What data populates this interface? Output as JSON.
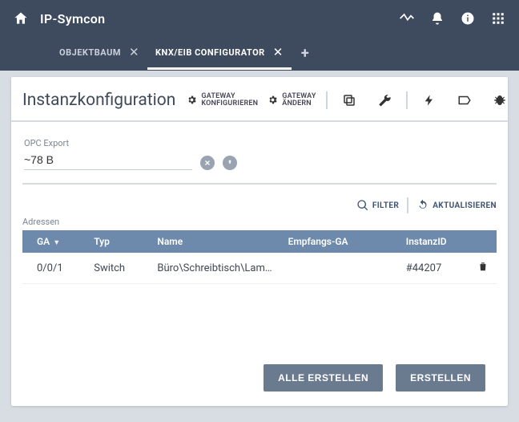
{
  "header": {
    "title": "IP-Symcon"
  },
  "tabs": [
    {
      "label": "OBJEKTBAUM",
      "active": false
    },
    {
      "label": "KNX/EIB CONFIGURATOR",
      "active": true
    }
  ],
  "panel": {
    "title": "Instanzkonfiguration",
    "gateway_configure": "GATEWAY\nKONFIGURIEREN",
    "gateway_change": "GATEWAY\nÄNDERN"
  },
  "opc": {
    "label": "OPC Export",
    "value": "~78 B"
  },
  "list": {
    "filter_label": "FILTER",
    "refresh_label": "AKTUALISIEREN",
    "caption": "Adressen",
    "columns": {
      "ga": "GA",
      "typ": "Typ",
      "name": "Name",
      "empfangs": "Empfangs-GA",
      "instanz": "InstanzID"
    },
    "rows": [
      {
        "ga": "0/0/1",
        "typ": "Switch",
        "name": "Büro\\Schreibtisch\\Lam…",
        "empfangs": "",
        "instanz": "#44207"
      }
    ]
  },
  "buttons": {
    "create_all": "ALLE ERSTELLEN",
    "create": "ERSTELLEN"
  }
}
